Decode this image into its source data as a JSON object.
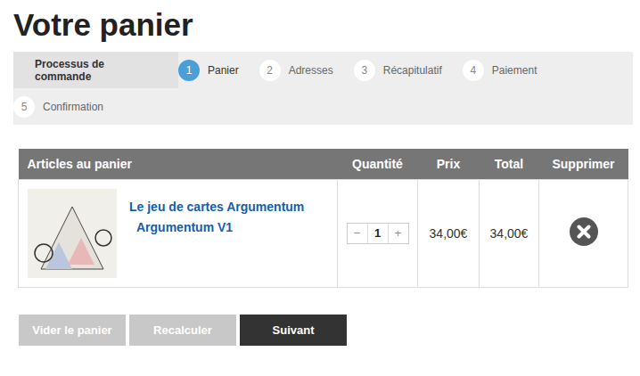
{
  "page": {
    "title": "Votre panier"
  },
  "steps": {
    "label": "Processus de commande",
    "items": [
      {
        "number": "1",
        "label": "Panier",
        "selected": true
      },
      {
        "number": "2",
        "label": "Adresses",
        "selected": false
      },
      {
        "number": "3",
        "label": "Récapitulatif",
        "selected": false
      },
      {
        "number": "4",
        "label": "Paiement",
        "selected": false
      },
      {
        "number": "5",
        "label": "Confirmation",
        "selected": false
      }
    ]
  },
  "table": {
    "columns": [
      "Articles au panier",
      "Quantité",
      "Prix",
      "Total",
      "Supprimer"
    ],
    "rows": [
      {
        "title": "Le jeu de cartes Argumentum",
        "variant": "Argumentum V1",
        "quantity": "1",
        "decrement": "−",
        "increment": "+",
        "price": "34,00€",
        "total": "34,00€"
      }
    ]
  },
  "buttons": [
    {
      "label": "Vider le panier",
      "primary": false
    },
    {
      "label": "Recalculer",
      "primary": false
    },
    {
      "label": "Suivant",
      "primary": true
    }
  ]
}
